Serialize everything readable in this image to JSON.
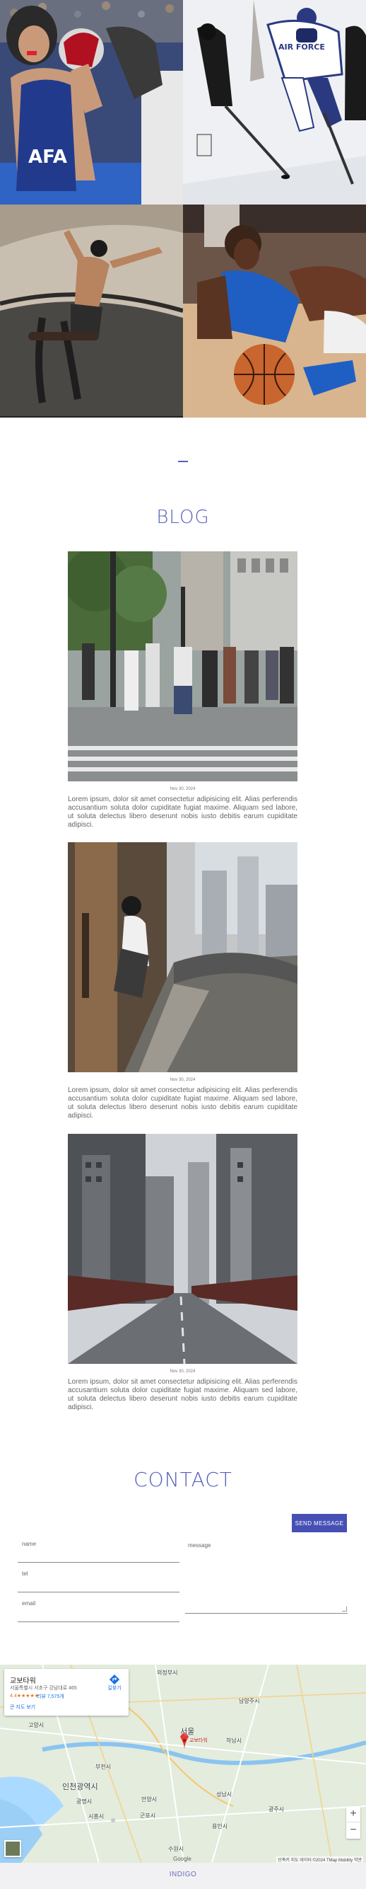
{
  "gallery": [
    {
      "name": "boxing",
      "jersey_text": "AFA"
    },
    {
      "name": "hockey",
      "jersey_text": "AIR FORCE"
    },
    {
      "name": "skateboarding",
      "jersey_text": ""
    },
    {
      "name": "basketball",
      "jersey_text": ""
    }
  ],
  "blog": {
    "title": "BLOG",
    "posts": [
      {
        "date": "Nov 30, 2024",
        "excerpt": "Lorem ipsum, dolor sit amet consectetur adipisicing elit. Alias perferendis accusantium soluta dolor cupiditate fugiat maxime. Aliquam sed labore, ut soluta delectus libero deserunt nobis iusto debitis earum cupiditate adipisci."
      },
      {
        "date": "Nov 30, 2024",
        "excerpt": "Lorem ipsum, dolor sit amet consectetur adipisicing elit. Alias perferendis accusantium soluta dolor cupiditate fugiat maxime. Aliquam sed labore, ut soluta delectus libero deserunt nobis iusto debitis earum cupiditate adipisci."
      },
      {
        "date": "Nov 30, 2024",
        "excerpt": "Lorem ipsum, dolor sit amet consectetur adipisicing elit. Alias perferendis accusantium soluta dolor cupiditate fugiat maxime. Aliquam sed labore, ut soluta delectus libero deserunt nobis iusto debitis earum cupiditate adipisci."
      }
    ]
  },
  "contact": {
    "title": "CONTACT",
    "send_label": "SEND MESSAGE",
    "fields": {
      "name": "name",
      "tel": "tel",
      "email": "email",
      "message": "message"
    }
  },
  "map": {
    "place_name": "교보타워",
    "address": "서울특별시 서초구 강남대로 465",
    "rating": "4.4★★★★★",
    "reviews": "리뷰 7,575개",
    "larger_map": "큰 지도 보기",
    "directions": "길찾기",
    "marker_label": "교보타워",
    "labels": [
      "의정부시",
      "남양주시",
      "고양시",
      "서울",
      "하남시",
      "부천시",
      "인천광역시",
      "광명시",
      "안양시",
      "성남시",
      "시흥시",
      "군포시",
      "광주시",
      "수원시",
      "용인시"
    ],
    "attribution": "단축키  지도 데이터 ©2024 TMap Mobility  약관",
    "zoom_in": "+",
    "zoom_out": "−",
    "logo": "Google"
  },
  "footer": {
    "brand": "INDIGO"
  },
  "colors": {
    "accent": "#5560b8",
    "button": "#4650b4",
    "footer_bg": "#f1f1f3"
  }
}
